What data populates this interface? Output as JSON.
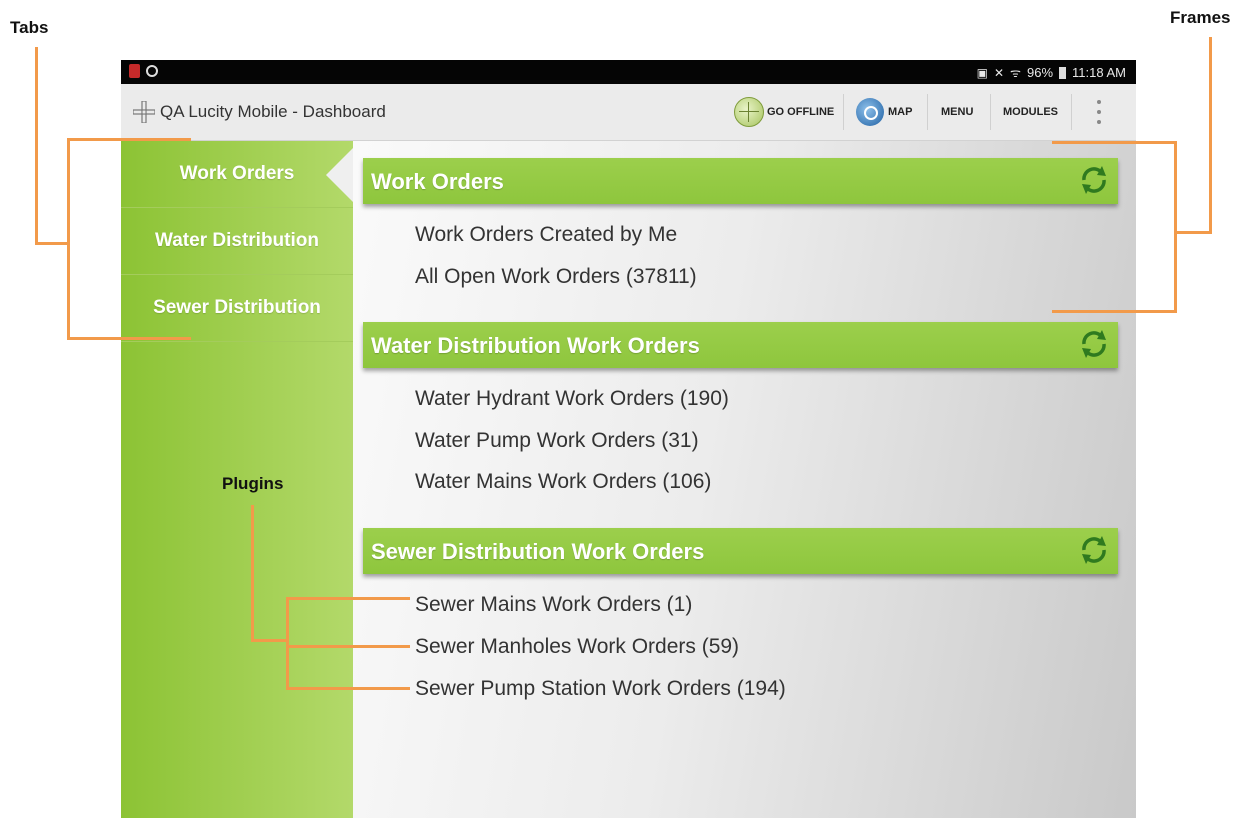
{
  "annotations": {
    "tabs": "Tabs",
    "frames": "Frames",
    "plugins": "Plugins"
  },
  "status_bar": {
    "right_text": "96%",
    "time": "11:18 AM"
  },
  "action_bar": {
    "title": "QA Lucity Mobile - Dashboard",
    "go_offline": "GO OFFLINE",
    "map": "MAP",
    "menu": "MENU",
    "modules": "MODULES"
  },
  "tabs": [
    {
      "label": "Work Orders",
      "active": true
    },
    {
      "label": "Water Distribution",
      "active": false
    },
    {
      "label": "Sewer Distribution",
      "active": false
    }
  ],
  "frames": [
    {
      "title": "Work Orders",
      "plugins": [
        "Work Orders Created by Me",
        "All Open Work Orders (37811)"
      ]
    },
    {
      "title": "Water Distribution Work Orders",
      "plugins": [
        "Water Hydrant Work Orders (190)",
        "Water Pump Work Orders (31)",
        "Water Mains Work Orders (106)"
      ]
    },
    {
      "title": "Sewer Distribution Work Orders",
      "plugins": [
        "Sewer Mains Work Orders (1)",
        "Sewer Manholes Work Orders (59)",
        "Sewer Pump Station Work Orders (194)"
      ]
    }
  ],
  "colors": {
    "accent_green": "#8ec63d",
    "annotation_orange": "#f29a4a"
  }
}
